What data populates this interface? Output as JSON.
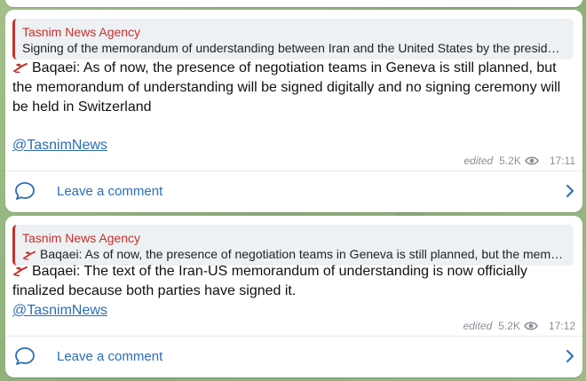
{
  "colors": {
    "accent": "#2b6db6",
    "reply_bar": "#c4302b",
    "meta": "#8a8f96",
    "background": "#8fb27f"
  },
  "posts": [
    {
      "reply_name": "Tasnim News Agency",
      "reply_text": "Signing of the memorandum of understanding between Iran and the United States by the presidents",
      "reply_icon": "",
      "message_icon": "tulip-icon",
      "message_text": "Baqaei: As of now, the presence of negotiation teams in Geneva is still planned, but the memorandum of understanding will be signed digitally and no signing ceremony will be held in Switzerland",
      "link": "@TasnimNews",
      "edited_label": "edited",
      "views": "5.2K",
      "time": "17:11",
      "comment_label": "Leave a comment"
    },
    {
      "reply_name": "Tasnim News Agency",
      "reply_icon": "tulip-icon",
      "reply_text": "Baqaei: As of now, the presence of negotiation teams in Geneva is still planned, but the memorandum",
      "message_icon": "tulip-icon",
      "message_text": "Baqaei: The text of the Iran-US memorandum of understanding is now officially finalized because both parties have signed it.",
      "link": "@TasnimNews",
      "edited_label": "edited",
      "views": "5.2K",
      "time": "17:12",
      "comment_label": "Leave a comment"
    }
  ]
}
